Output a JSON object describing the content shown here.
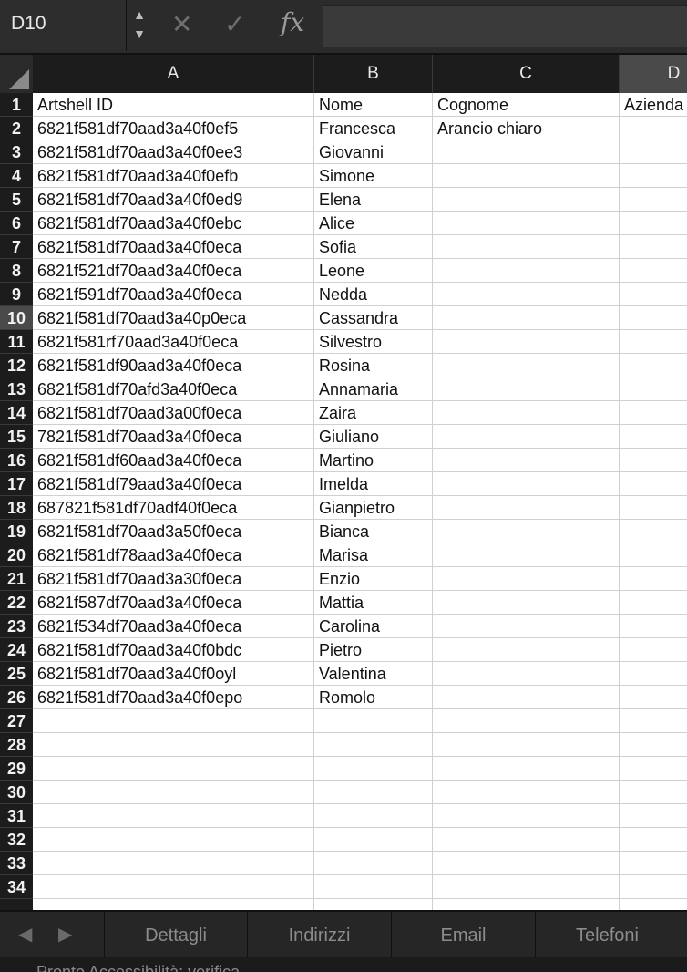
{
  "formula_bar": {
    "cell_ref": "D10",
    "fx_label": "fx",
    "formula_value": ""
  },
  "columns": [
    "A",
    "B",
    "C",
    "D"
  ],
  "header_row": [
    "Artshell ID",
    "Nome",
    "Cognome",
    "Azienda"
  ],
  "rows": [
    [
      "6821f581df70aad3a40f0ef5",
      "Francesca",
      "Arancio chiaro"
    ],
    [
      "6821f581df70aad3a40f0ee3",
      "Giovanni",
      ""
    ],
    [
      "6821f581df70aad3a40f0efb",
      "Simone",
      ""
    ],
    [
      "6821f581df70aad3a40f0ed9",
      "Elena",
      ""
    ],
    [
      "6821f581df70aad3a40f0ebc",
      "Alice",
      ""
    ],
    [
      "6821f581df70aad3a40f0eca",
      "Sofia",
      ""
    ],
    [
      "6821f521df70aad3a40f0eca",
      "Leone",
      ""
    ],
    [
      "6821f591df70aad3a40f0eca",
      "Nedda",
      ""
    ],
    [
      "6821f581df70aad3a40p0eca",
      "Cassandra",
      ""
    ],
    [
      "6821f581rf70aad3a40f0eca",
      "Silvestro",
      ""
    ],
    [
      "6821f581df90aad3a40f0eca",
      "Rosina",
      ""
    ],
    [
      "6821f581df70afd3a40f0eca",
      "Annamaria",
      ""
    ],
    [
      "6821f581df70aad3a00f0eca",
      "Zaira",
      ""
    ],
    [
      "7821f581df70aad3a40f0eca",
      "Giuliano",
      ""
    ],
    [
      "6821f581df60aad3a40f0eca",
      "Martino",
      ""
    ],
    [
      "6821f581df79aad3a40f0eca",
      "Imelda",
      ""
    ],
    [
      "687821f581df70adf40f0eca",
      "Gianpietro",
      ""
    ],
    [
      "6821f581df70aad3a50f0eca",
      "Bianca",
      ""
    ],
    [
      "6821f581df78aad3a40f0eca",
      "Marisa",
      ""
    ],
    [
      "6821f581df70aad3a30f0eca",
      "Enzio",
      ""
    ],
    [
      "6821f587df70aad3a40f0eca",
      "Mattia",
      ""
    ],
    [
      "6821f534df70aad3a40f0eca",
      "Carolina",
      ""
    ],
    [
      "6821f581df70aad3a40f0bdc",
      "Pietro",
      ""
    ],
    [
      "6821f581df70aad3a40f0oyl",
      "Valentina",
      ""
    ],
    [
      "6821f581df70aad3a40f0epo",
      "Romolo",
      ""
    ]
  ],
  "row_numbers": [
    "1",
    "2",
    "3",
    "4",
    "5",
    "6",
    "7",
    "8",
    "9",
    "10",
    "11",
    "12",
    "13",
    "14",
    "15",
    "16",
    "17",
    "18",
    "19",
    "20",
    "21",
    "22",
    "23",
    "24",
    "25",
    "26",
    "27",
    "28",
    "29",
    "30",
    "31",
    "32",
    "33",
    "34"
  ],
  "active_row": "10",
  "active_column": "D",
  "sheet_tabs": [
    "Dettagli",
    "Indirizzi",
    "Email",
    "Telefoni"
  ],
  "status_text": "Pronto   Accessibilità: verifica",
  "icons": {
    "cancel": "close-icon",
    "confirm": "check-icon",
    "nav_prev": "chevron-left-icon",
    "nav_next": "chevron-right-icon"
  }
}
